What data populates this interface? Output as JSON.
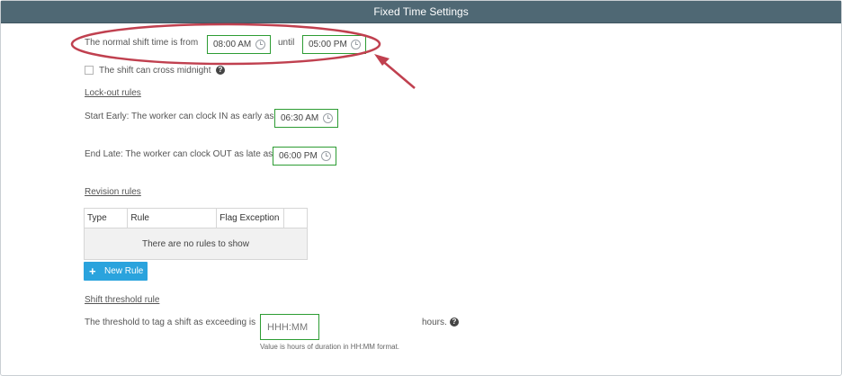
{
  "window": {
    "title": "Fixed Time Settings"
  },
  "shift": {
    "label_from": "The normal shift time is from",
    "start": "08:00 AM",
    "label_until": "until",
    "end": "05:00 PM",
    "cross_midnight_label": "The shift can cross midnight",
    "cross_midnight_checked": false
  },
  "lockout": {
    "heading": "Lock-out rules",
    "start_early_label": "Start Early: The worker can clock IN as early as",
    "start_early_value": "06:30 AM",
    "end_late_label": "End Late: The worker can clock OUT as late as",
    "end_late_value": "06:00 PM"
  },
  "revision": {
    "heading": "Revision rules",
    "columns": [
      "Type",
      "Rule",
      "Flag Exception"
    ],
    "empty_message": "There are no rules to show",
    "new_rule_label": "New Rule"
  },
  "threshold": {
    "heading": "Shift threshold rule",
    "label": "The threshold to tag a shift as exceeding is",
    "placeholder": "HHH:MM",
    "unit": "hours.",
    "hint": "Value is hours of duration in HH:MM format."
  },
  "help_glyph": "?",
  "colors": {
    "titlebar": "#4f6874",
    "field_border": "#2d9c33",
    "button": "#2aa3dd",
    "annotation": "#c0404f"
  }
}
